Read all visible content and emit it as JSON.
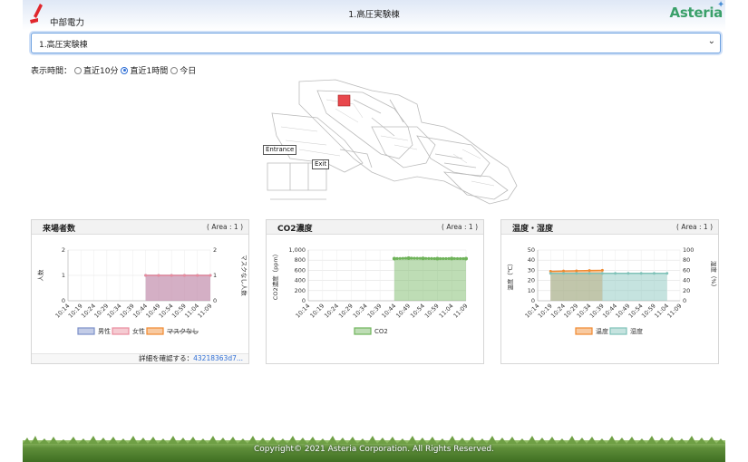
{
  "header": {
    "company_logo_text": "中部電力",
    "title": "1.高圧実験棟",
    "brand_logo_text": "Asteria",
    "brand_color": "#3aa06a"
  },
  "area_select": {
    "selected": "1.高圧実験棟"
  },
  "time_filter": {
    "label": "表示時間：",
    "options": [
      {
        "label": "直近10分",
        "selected": false
      },
      {
        "label": "直近1時間",
        "selected": true
      },
      {
        "label": "今日",
        "selected": false
      }
    ]
  },
  "map": {
    "labels": [
      "Entrance",
      "Exit"
    ],
    "highlight_color": "#e8474c"
  },
  "panels": [
    {
      "title": "来場者数",
      "area": "( Area : 1 )",
      "footer_label": "詳細を確認する：",
      "footer_link": "43218363d7..."
    },
    {
      "title": "CO2濃度",
      "area": "( Area : 1 )"
    },
    {
      "title": "温度・湿度",
      "area": "( Area : 1 )"
    }
  ],
  "chart_data": [
    {
      "type": "area",
      "categories": [
        "10:14",
        "10:19",
        "10:24",
        "10:29",
        "10:34",
        "10:39",
        "10:44",
        "10:49",
        "10:54",
        "10:59",
        "11:04",
        "11:09"
      ],
      "ylabel": "人数",
      "y2label": "マスクなし人数",
      "ylim": [
        0,
        2
      ],
      "y2lim": [
        0,
        2
      ],
      "yticks": [
        "0",
        "1",
        "2"
      ],
      "series": [
        {
          "name": "男性",
          "color": "#7b8fc9",
          "values": [
            null,
            null,
            null,
            null,
            null,
            null,
            1,
            1,
            1,
            1,
            1,
            1
          ]
        },
        {
          "name": "女性",
          "color": "#e88b9c",
          "values": [
            null,
            null,
            null,
            null,
            null,
            null,
            1,
            1,
            1,
            1,
            1,
            1
          ]
        },
        {
          "name": "マスクなし",
          "color": "#f0892e",
          "values": []
        }
      ]
    },
    {
      "type": "area",
      "categories": [
        "10:14",
        "10:19",
        "10:24",
        "10:29",
        "10:34",
        "10:39",
        "10:44",
        "10:49",
        "10:54",
        "10:59",
        "11:04",
        "11:09"
      ],
      "ylabel": "CO2濃度（ppm）",
      "ylim": [
        0,
        1000
      ],
      "yticks": [
        "0",
        "200",
        "400",
        "600",
        "800",
        "1,000"
      ],
      "series": [
        {
          "name": "CO2",
          "color": "#6fb35a",
          "values": [
            null,
            null,
            null,
            null,
            null,
            null,
            830,
            840,
            835,
            830,
            832,
            830
          ]
        }
      ]
    },
    {
      "type": "area",
      "categories": [
        "10:14",
        "10:19",
        "10:24",
        "10:29",
        "10:34",
        "10:39",
        "10:44",
        "10:49",
        "10:54",
        "10:59",
        "11:04",
        "11:09"
      ],
      "ylabel": "温度（℃）",
      "y2label": "湿度（%）",
      "ylim": [
        0,
        50
      ],
      "y2lim": [
        0,
        100
      ],
      "yticks": [
        "0",
        "10",
        "20",
        "30",
        "40",
        "50"
      ],
      "y2ticks": [
        "0",
        "20",
        "40",
        "60",
        "80",
        "100"
      ],
      "series": [
        {
          "name": "温度",
          "axis": "left",
          "color": "#f0892e",
          "values": [
            null,
            29,
            29.3,
            29.5,
            29.8,
            30,
            null,
            null,
            null,
            null,
            null,
            null
          ]
        },
        {
          "name": "湿度",
          "axis": "right",
          "color": "#7fc2b8",
          "values": [
            null,
            54,
            54,
            54,
            54,
            54,
            54,
            54,
            54,
            54,
            54,
            null
          ]
        }
      ]
    }
  ],
  "footer": {
    "copyright": "Copyright© 2021 Asteria Corporation. All Rights Reserved."
  }
}
